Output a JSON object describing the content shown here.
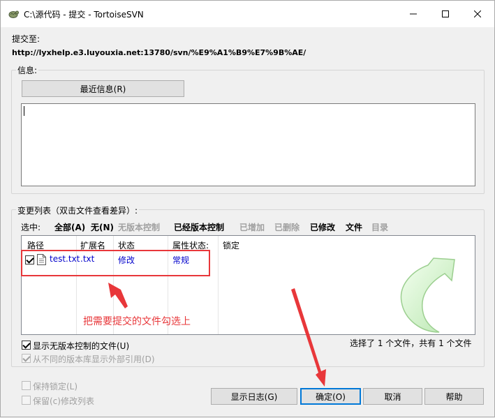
{
  "window": {
    "title": "C:\\源代码 - 提交 - TortoiseSVN"
  },
  "commit": {
    "label": "提交至:",
    "url": "http://lyxhelp.e3.luyouxia.net:13780/svn/%E9%A1%B9%E7%9B%AE/"
  },
  "message": {
    "group_title": "信息:",
    "recent_button": "最近信息(R)",
    "text": ""
  },
  "changes": {
    "group_title": "变更列表（双击文件查看差异）:",
    "select_label": "选中:",
    "filters": [
      {
        "label": "全部(A)",
        "enabled": true
      },
      {
        "label": "无(N)",
        "enabled": true
      },
      {
        "label": "无版本控制",
        "enabled": false
      },
      {
        "label": "已经版本控制",
        "enabled": true
      },
      {
        "label": "已增加",
        "enabled": false
      },
      {
        "label": "已删除",
        "enabled": false
      },
      {
        "label": "已修改",
        "enabled": true
      },
      {
        "label": "文件",
        "enabled": true
      },
      {
        "label": "目录",
        "enabled": false
      }
    ],
    "columns": [
      "路径",
      "扩展名",
      "状态",
      "属性状态:",
      "锁定"
    ],
    "rows": [
      {
        "checked": true,
        "path": "test.txt",
        "ext": ".txt",
        "status": "修改",
        "prop_status": "常规",
        "lock": ""
      }
    ],
    "summary": "选择了 1 个文件，共有 1 个文件",
    "show_unversioned": {
      "label": "显示无版本控制的文件(U)",
      "checked": true
    },
    "show_externals": {
      "label": "从不同的版本库显示外部引用(D)",
      "checked": true,
      "enabled": false
    }
  },
  "options": {
    "keep_locks": {
      "label": "保持锁定(L)",
      "checked": false
    },
    "keep_changelists": {
      "label": "保留(c)修改列表",
      "checked": false
    }
  },
  "buttons": {
    "show_log": "显示日志(G)",
    "ok": "确定(O)",
    "cancel": "取消",
    "help": "帮助"
  },
  "annotation": {
    "note": "把需要提交的文件勾选上",
    "color": "#e8373a"
  },
  "colors": {
    "link_blue": "#0000cc",
    "accent": "#0078d7",
    "disabled": "#a0a0a0"
  }
}
